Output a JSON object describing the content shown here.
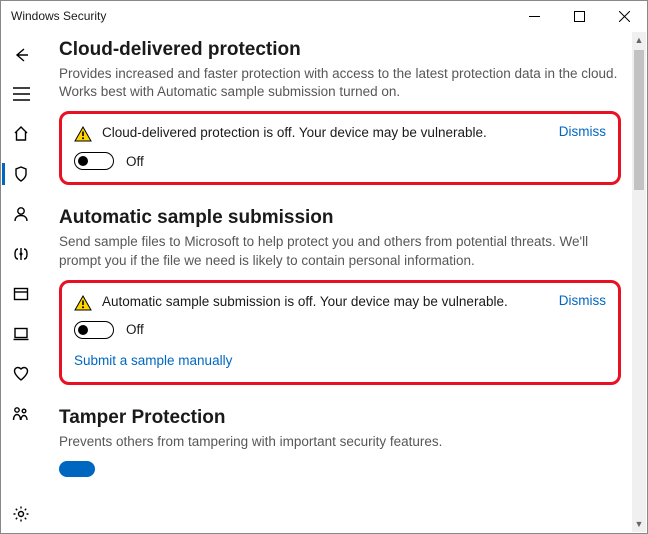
{
  "window": {
    "title": "Windows Security"
  },
  "sections": {
    "cloud": {
      "heading": "Cloud-delivered protection",
      "desc": "Provides increased and faster protection with access to the latest protection data in the cloud. Works best with Automatic sample submission turned on.",
      "warning": "Cloud-delivered protection is off. Your device may be vulnerable.",
      "dismiss": "Dismiss",
      "toggle_state": "Off"
    },
    "auto": {
      "heading": "Automatic sample submission",
      "desc": "Send sample files to Microsoft to help protect you and others from potential threats. We'll prompt you if the file we need is likely to contain personal information.",
      "warning": "Automatic sample submission is off. Your device may be vulnerable.",
      "dismiss": "Dismiss",
      "toggle_state": "Off",
      "link": "Submit a sample manually"
    },
    "tamper": {
      "heading": "Tamper Protection",
      "desc": "Prevents others from tampering with important security features."
    }
  }
}
